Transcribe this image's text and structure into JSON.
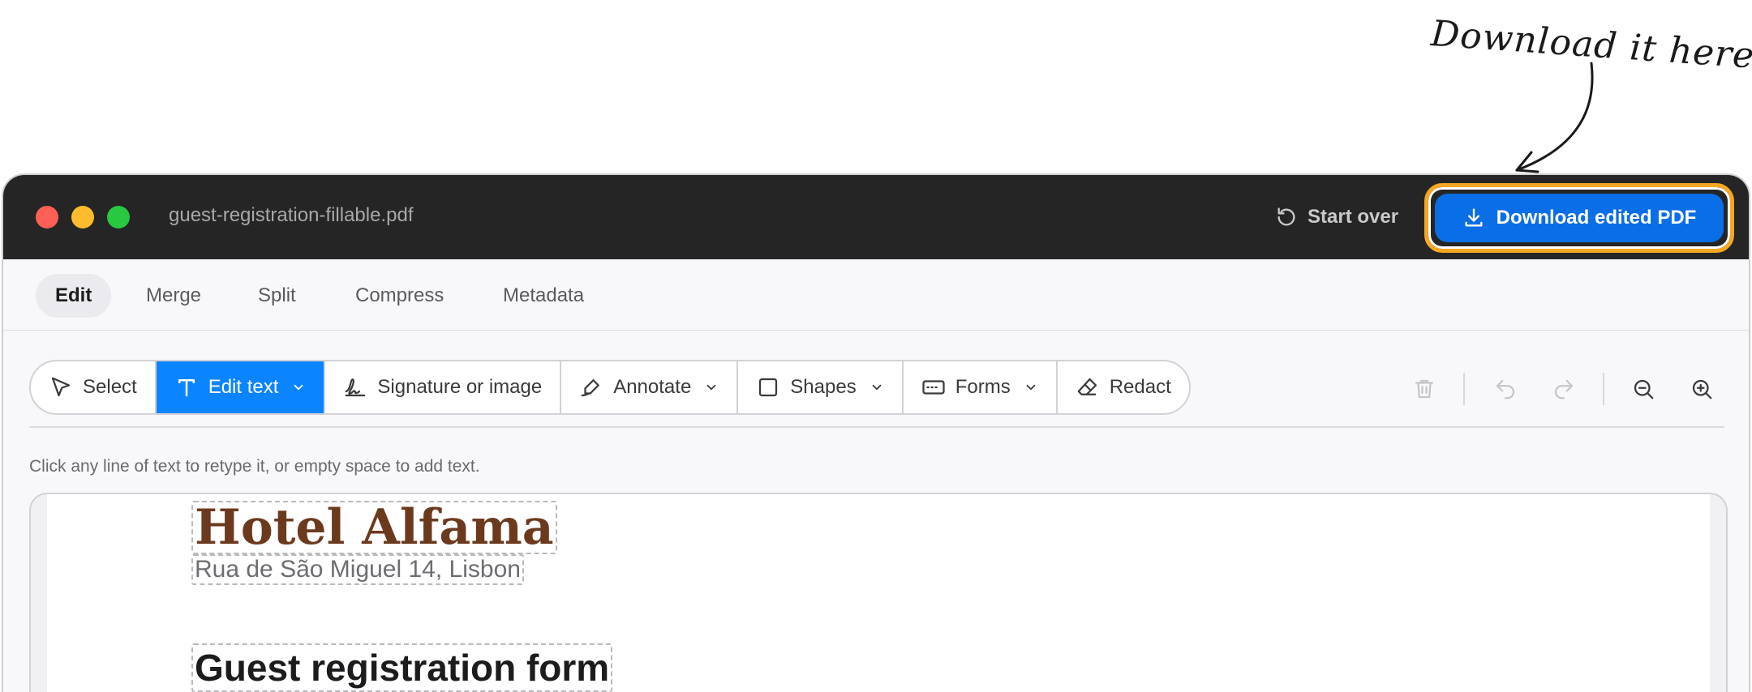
{
  "annotation": {
    "text": "Download it here"
  },
  "window": {
    "filename": "guest-registration-fillable.pdf",
    "start_over_label": "Start over",
    "download_label": "Download edited PDF",
    "download_highlight_color": "#f5a623",
    "primary_color": "#0a84ff"
  },
  "tabs": [
    {
      "label": "Edit",
      "active": true
    },
    {
      "label": "Merge",
      "active": false
    },
    {
      "label": "Split",
      "active": false
    },
    {
      "label": "Compress",
      "active": false
    },
    {
      "label": "Metadata",
      "active": false
    }
  ],
  "toolbar": {
    "tools": [
      {
        "label": "Select",
        "icon": "cursor-icon",
        "has_dropdown": false,
        "active": false
      },
      {
        "label": "Edit text",
        "icon": "text-icon",
        "has_dropdown": true,
        "active": true
      },
      {
        "label": "Signature or image",
        "icon": "signature-icon",
        "has_dropdown": false,
        "active": false
      },
      {
        "label": "Annotate",
        "icon": "pen-icon",
        "has_dropdown": true,
        "active": false
      },
      {
        "label": "Shapes",
        "icon": "square-icon",
        "has_dropdown": true,
        "active": false
      },
      {
        "label": "Forms",
        "icon": "form-field-icon",
        "has_dropdown": true,
        "active": false
      },
      {
        "label": "Redact",
        "icon": "eraser-icon",
        "has_dropdown": false,
        "active": false
      }
    ],
    "right_icons": [
      "trash-icon",
      "undo-icon",
      "redo-icon",
      "zoom-out-icon",
      "zoom-in-icon"
    ]
  },
  "hint": "Click any line of text to retype it, or empty space to add text.",
  "document": {
    "hotel_name": "Hotel Alfama",
    "hotel_address": "Rua de São Miguel 14, Lisbon",
    "form_title": "Guest registration form",
    "hotel_name_color": "#6b3a1e"
  }
}
